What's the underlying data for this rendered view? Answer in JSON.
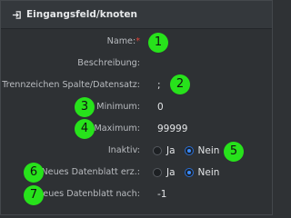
{
  "header": {
    "icon": "sign-in-icon",
    "title": "Eingangsfeld/knoten"
  },
  "fields": {
    "name": {
      "label": "Name:",
      "required_mark": "*",
      "value": ""
    },
    "beschreibung": {
      "label": "Beschreibung:",
      "value": ""
    },
    "trennzeichen": {
      "label": "Trennzeichen Spalte/Datensatz:",
      "value": ";"
    },
    "minimum": {
      "label": "Minimum:",
      "value": "0"
    },
    "maximum": {
      "label": "Maximum:",
      "value": "99999"
    },
    "inaktiv": {
      "label": "Inaktiv:",
      "option_ja": "Ja",
      "option_nein": "Nein",
      "selected": "Nein"
    },
    "neues_datenblatt_erz": {
      "label": "Neues Datenblatt erz.:",
      "option_ja": "Ja",
      "option_nein": "Nein",
      "selected": "Nein"
    },
    "neues_datenblatt_nach": {
      "label": "Neues Datenblatt nach:",
      "value": "-1"
    }
  },
  "callouts": [
    "1",
    "2",
    "3",
    "4",
    "5",
    "6",
    "7"
  ],
  "colors": {
    "callout": "#27e21b",
    "required": "#e0453a",
    "radio_selected": "#3a8bff"
  }
}
